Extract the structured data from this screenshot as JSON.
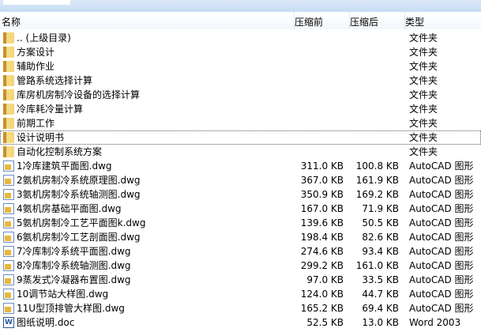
{
  "columns": {
    "name": "名称",
    "size": "压缩前",
    "compressed": "压缩后",
    "type": "类型"
  },
  "rows": [
    {
      "icon": "folder",
      "name": ".. (上级目录)",
      "size": "",
      "compressed": "",
      "type": "文件夹"
    },
    {
      "icon": "folder",
      "name": "方案设计",
      "size": "",
      "compressed": "",
      "type": "文件夹"
    },
    {
      "icon": "folder",
      "name": "辅助作业",
      "size": "",
      "compressed": "",
      "type": "文件夹"
    },
    {
      "icon": "folder",
      "name": "管路系统选择计算",
      "size": "",
      "compressed": "",
      "type": "文件夹"
    },
    {
      "icon": "folder",
      "name": "库房机房制冷设备的选择计算",
      "size": "",
      "compressed": "",
      "type": "文件夹"
    },
    {
      "icon": "folder",
      "name": "冷库耗冷量计算",
      "size": "",
      "compressed": "",
      "type": "文件夹"
    },
    {
      "icon": "folder",
      "name": "前期工作",
      "size": "",
      "compressed": "",
      "type": "文件夹"
    },
    {
      "icon": "folder",
      "name": "设计说明书",
      "size": "",
      "compressed": "",
      "type": "文件夹"
    },
    {
      "icon": "folder",
      "name": "自动化控制系统方案",
      "size": "",
      "compressed": "",
      "type": "文件夹"
    },
    {
      "icon": "dwg",
      "name": "1冷库建筑平面图.dwg",
      "size": "311.0 KB",
      "compressed": "100.8 KB",
      "type": "AutoCAD 图形"
    },
    {
      "icon": "dwg",
      "name": "2氨机房制冷系统原理图.dwg",
      "size": "367.0 KB",
      "compressed": "161.9 KB",
      "type": "AutoCAD 图形"
    },
    {
      "icon": "dwg",
      "name": "3氨机房制冷系统轴测图.dwg",
      "size": "350.9 KB",
      "compressed": "169.2 KB",
      "type": "AutoCAD 图形"
    },
    {
      "icon": "dwg",
      "name": "4氨机房基础平面图.dwg",
      "size": "167.0 KB",
      "compressed": "71.9 KB",
      "type": "AutoCAD 图形"
    },
    {
      "icon": "dwg",
      "name": "5氨机房制冷工艺平面图k.dwg",
      "size": "139.6 KB",
      "compressed": "50.5 KB",
      "type": "AutoCAD 图形"
    },
    {
      "icon": "dwg",
      "name": "6氨机房制冷工艺剖面图.dwg",
      "size": "198.4 KB",
      "compressed": "82.6 KB",
      "type": "AutoCAD 图形"
    },
    {
      "icon": "dwg",
      "name": "7冷库制冷系统平面图.dwg",
      "size": "274.6 KB",
      "compressed": "93.4 KB",
      "type": "AutoCAD 图形"
    },
    {
      "icon": "dwg",
      "name": "8冷库制冷系统轴测图.dwg",
      "size": "299.2 KB",
      "compressed": "161.0 KB",
      "type": "AutoCAD 图形"
    },
    {
      "icon": "dwg",
      "name": "9蒸发式冷凝器布置图.dwg",
      "size": "97.0 KB",
      "compressed": "33.5 KB",
      "type": "AutoCAD 图形"
    },
    {
      "icon": "dwg",
      "name": "10调节站大样图.dwg",
      "size": "124.0 KB",
      "compressed": "44.7 KB",
      "type": "AutoCAD 图形"
    },
    {
      "icon": "dwg",
      "name": "11U型顶排管大样图.dwg",
      "size": "165.2 KB",
      "compressed": "69.4 KB",
      "type": "AutoCAD 图形"
    },
    {
      "icon": "doc",
      "name": "图纸说明.doc",
      "size": "52.5 KB",
      "compressed": "13.0 KB",
      "type": "Word 2003"
    }
  ]
}
